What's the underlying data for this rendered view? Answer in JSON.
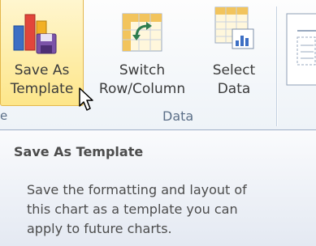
{
  "ribbon": {
    "buttons": [
      {
        "line1": "Save As",
        "line2": "Template",
        "icon": "chart-template-icon"
      },
      {
        "line1": "Switch",
        "line2": "Row/Column",
        "icon": "switch-row-column-icon"
      },
      {
        "line1": "Select",
        "line2": "Data",
        "icon": "select-data-icon"
      }
    ],
    "left_group_label": "e",
    "data_group_label": "Data"
  },
  "tooltip": {
    "title": "Save As Template",
    "body_lines": [
      "Save the formatting and layout of",
      "this chart as a template you can",
      "apply to future charts."
    ]
  },
  "colors": {
    "hover_fill": "#fde68a",
    "hover_border": "#e3b74c",
    "ribbon_bg": "#eef3f8"
  }
}
